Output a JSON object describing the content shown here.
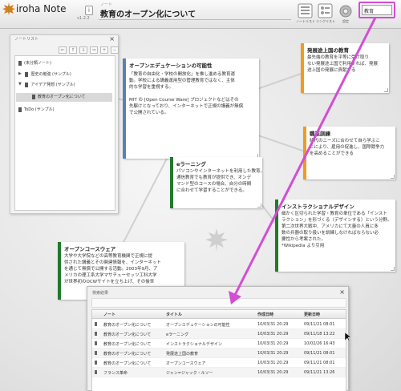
{
  "header": {
    "app_name": "iroha Note",
    "version": "v1.2.2",
    "doc_label": "ノート",
    "doc_title": "教育のオープン化について",
    "info_label": "i",
    "tools": [
      {
        "label": "ノートリスト",
        "icon": "notebook-icon"
      },
      {
        "label": "リンクリスト",
        "icon": "link-list-icon"
      },
      {
        "label": "設定",
        "icon": "gear-icon"
      }
    ],
    "search_value": "教育",
    "accent": "#d24ed4"
  },
  "notelist": {
    "title": "ノートリスト",
    "close_label": "×",
    "toolbar": [
      "⇐",
      "⇑",
      "⇓",
      "⇒",
      "+",
      "−"
    ],
    "items": [
      {
        "label": "(未分類ノート)",
        "indent": 0,
        "expander": "",
        "selected": false
      },
      {
        "label": "歴史の勉強 (サンプル)",
        "indent": 0,
        "expander": "▶",
        "selected": false
      },
      {
        "label": "アイデア発想 (サンプル)",
        "indent": 0,
        "expander": "▼",
        "selected": false
      },
      {
        "label": "教育のオープン化について",
        "indent": 1,
        "expander": "",
        "selected": true
      },
      {
        "label": "ToDo (サンプル)",
        "indent": 0,
        "expander": "",
        "selected": false
      }
    ]
  },
  "notes": {
    "opened": {
      "title": "オープンエデュケーションの可能性",
      "body": "「教育の自由化・学校の開放化」を推し進める教育運\n動。学校による講義運用型の管理教育ではなく、主体\n的な学習を重視する。\n\nMIT の [Open Course Ware] プロジェクトなどはその\n先駆けとなっており、インターネットで正規の講義が無償\nで公開されている。",
      "color": "#5b7fb8"
    },
    "developing": {
      "title": "発展途上国の教育",
      "body": "最先端の教育を平等に受け取り\nない発展途上国で利用すれば、発展\n途上国の発展に貢献する",
      "color": "#f39a1e"
    },
    "training": {
      "title": "職業訓練",
      "body": "時代のニーズに合わせて自ら学ぶこ\nとにより、雇用の促進し、国際競争力\nを高めることができる",
      "color": "#f39a1e"
    },
    "elearning": {
      "title": "eラーニング",
      "body": "パソコンやインターネットを利用した教育。\n通信教育でも教育が提供でき、オンデ\nマンド型のコースの場合、自分の時間\nに合わせて学習することができる。",
      "color": "#1f7a2a"
    },
    "instructional": {
      "title": "インストラクショナルデザイン",
      "body": "細かく区切られた学習・教育の単位である「インスト\nラクション」を形づくる（デザインする）という分野。\n第二次世界大戦中、アメリカにて大量の人員に多\n数の兵器の取り扱いを訓練しなければならない必\n要性から考案された。\n*Wikipedia より引用",
      "color": "#1f7a2a"
    },
    "ocw": {
      "title": "オープンコースウェア",
      "body": "大学や大学院などの高等教育機関で正規に提\n供された講義とその関連情報を、インターネット\nを通じて無償で公開する活動。2003年9月、ア\nメリカの理工系大学マサチューセッツ工科大学\nが世界初のOCWサイトを立ち上げ、その後世",
      "color": "#1f7a2a"
    }
  },
  "search_dialog": {
    "title": "検索結果",
    "close_label": "×",
    "columns": [
      "ノート",
      "タイトル",
      "作成日時",
      "更新日時"
    ],
    "rows": [
      [
        "教育のオープン化について",
        "オープンエデュケーションの可能性",
        "10/03/31 20:29",
        "09/11/21 08:01"
      ],
      [
        "教育のオープン化について",
        "eラーニング",
        "10/03/31 20:29",
        "09/11/18 13:22"
      ],
      [
        "教育のオープン化について",
        "インストラクショナルデザイン",
        "10/03/31 20:29",
        "10/02/26 16:43"
      ],
      [
        "教育のオープン化について",
        "発展途上国の教育",
        "10/03/31 20:29",
        "09/11/21 08:01"
      ],
      [
        "教育のオープン化について",
        "オープンコースウェア",
        "10/03/31 20:29",
        "09/11/21 08:01"
      ],
      [
        "フランス革命",
        "ジャン=ジャック・ルソー",
        "10/03/31 20:29",
        "09/11/21 13:26"
      ]
    ]
  }
}
